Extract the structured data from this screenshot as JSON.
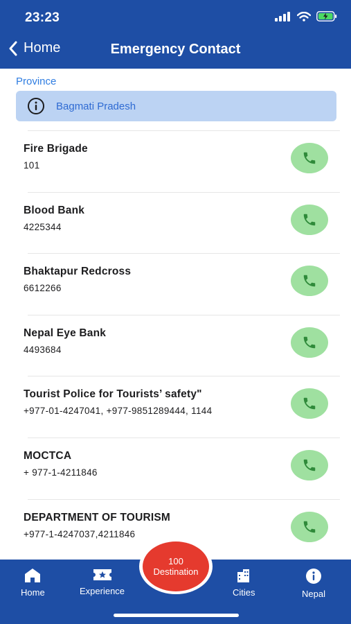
{
  "status_bar": {
    "time": "23:23"
  },
  "header": {
    "back_label": "Home",
    "title": "Emergency Contact"
  },
  "province": {
    "label": "Province",
    "value": "Bagmati Pradesh"
  },
  "contacts": [
    {
      "name": "Fire Brigade",
      "number": "101"
    },
    {
      "name": "Blood Bank",
      "number": "4225344"
    },
    {
      "name": "Bhaktapur Redcross",
      "number": "6612266"
    },
    {
      "name": "Nepal Eye Bank",
      "number": "4493684"
    },
    {
      "name": "Tourist Police for Tourists’ safety\"",
      "number": "+977-01-4247041, +977-9851289444, 1144"
    },
    {
      "name": "MOCTCA",
      "number": "+ 977-1-4211846"
    },
    {
      "name": "DEPARTMENT OF TOURISM",
      "number": "+977-1-4247037,4211846"
    }
  ],
  "tabs": {
    "home": "Home",
    "experience": "Experience",
    "destination_line1": "100",
    "destination_line2": "Destination",
    "cities": "Cities",
    "nepal": "Nepal"
  },
  "colors": {
    "primary": "#1e4ea5",
    "call_button": "#9fe0a0",
    "call_icon": "#2f8a3a",
    "destination_button": "#e53a2e",
    "link_blue": "#2f7de1"
  },
  "icons": {
    "back": "chevron-left-icon",
    "info": "info-circle-icon",
    "call": "phone-icon",
    "home": "home-icon",
    "experience": "ticket-icon",
    "cities": "buildings-icon",
    "nepal": "info-icon"
  }
}
